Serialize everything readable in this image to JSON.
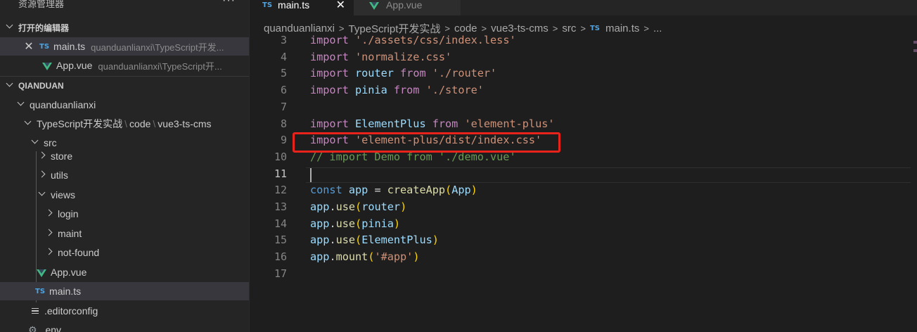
{
  "sidebar": {
    "title": "资源管理器",
    "more": "···",
    "open_editors_label": "打开的编辑器",
    "open_editors": [
      {
        "name": "main.ts",
        "path": "quanduanlianxi\\TypeScript开发...",
        "icon": "ts-icon"
      },
      {
        "name": "App.vue",
        "path": "quanduanlianxi\\TypeScript开...",
        "icon": "vue-icon"
      }
    ],
    "workspace_label": "QIANDUAN",
    "tree": {
      "root": "quanduanlianxi",
      "project_parts": [
        "TypeScript开发实战",
        "code",
        "vue3-ts-cms"
      ],
      "src": "src",
      "store": "store",
      "utils": "utils",
      "views": "views",
      "login": "login",
      "maint": "maint",
      "not_found": "not-found",
      "app_vue": "App.vue",
      "main_ts": "main.ts",
      "editorconfig": ".editorconfig",
      "env": ".env"
    }
  },
  "tabs": [
    {
      "label": "main.ts",
      "icon_text": "TS",
      "close": "✕"
    },
    {
      "label": "App.vue"
    }
  ],
  "breadcrumb": [
    "quanduanlianxi",
    "TypeScript开发实战",
    "code",
    "vue3-ts-cms",
    "src",
    "main.ts",
    "..."
  ],
  "ts_icon_text": "TS",
  "editor": {
    "lines": [
      {
        "n": "3",
        "t": [
          [
            "k",
            "import "
          ],
          [
            "s",
            "'./assets/css/index.less'"
          ]
        ]
      },
      {
        "n": "4",
        "t": [
          [
            "k",
            "import "
          ],
          [
            "s",
            "'normalize.css'"
          ]
        ]
      },
      {
        "n": "5",
        "t": [
          [
            "k",
            "import "
          ],
          [
            "v",
            "router"
          ],
          [
            "k",
            " from "
          ],
          [
            "s",
            "'./router'"
          ]
        ]
      },
      {
        "n": "6",
        "t": [
          [
            "k",
            "import "
          ],
          [
            "v",
            "pinia"
          ],
          [
            "k",
            " from "
          ],
          [
            "s",
            "'./store'"
          ]
        ]
      },
      {
        "n": "7",
        "t": []
      },
      {
        "n": "8",
        "t": [
          [
            "k",
            "import "
          ],
          [
            "v",
            "ElementPlus"
          ],
          [
            "k",
            " from "
          ],
          [
            "s",
            "'element-plus'"
          ]
        ]
      },
      {
        "n": "9",
        "t": [
          [
            "k",
            "import "
          ],
          [
            "s",
            "'element-plus/dist/index.css'"
          ]
        ]
      },
      {
        "n": "10",
        "t": [
          [
            "c",
            "// import Demo from './demo.vue'"
          ]
        ]
      },
      {
        "n": "11",
        "t": []
      },
      {
        "n": "12",
        "t": [
          [
            "b",
            "const "
          ],
          [
            "v",
            "app"
          ],
          [
            "p",
            " = "
          ],
          [
            "f",
            "createApp"
          ],
          [
            "y",
            "("
          ],
          [
            "v",
            "App"
          ],
          [
            "y",
            ")"
          ]
        ]
      },
      {
        "n": "13",
        "t": [
          [
            "v",
            "app"
          ],
          [
            "p",
            "."
          ],
          [
            "f",
            "use"
          ],
          [
            "y",
            "("
          ],
          [
            "v",
            "router"
          ],
          [
            "y",
            ")"
          ]
        ]
      },
      {
        "n": "14",
        "t": [
          [
            "v",
            "app"
          ],
          [
            "p",
            "."
          ],
          [
            "f",
            "use"
          ],
          [
            "y",
            "("
          ],
          [
            "v",
            "pinia"
          ],
          [
            "y",
            ")"
          ]
        ]
      },
      {
        "n": "15",
        "t": [
          [
            "v",
            "app"
          ],
          [
            "p",
            "."
          ],
          [
            "f",
            "use"
          ],
          [
            "y",
            "("
          ],
          [
            "v",
            "ElementPlus"
          ],
          [
            "y",
            ")"
          ]
        ]
      },
      {
        "n": "16",
        "t": [
          [
            "v",
            "app"
          ],
          [
            "p",
            "."
          ],
          [
            "f",
            "mount"
          ],
          [
            "y",
            "("
          ],
          [
            "s",
            "'#app'"
          ],
          [
            "y",
            ")"
          ]
        ]
      },
      {
        "n": "17",
        "t": []
      }
    ],
    "current_line": "11",
    "highlighted_line": "9"
  },
  "colors": {
    "keyword": "#c586c0",
    "string": "#ce9178",
    "variable": "#9cdcfe",
    "comment": "#6a9955",
    "function": "#dcdcaa",
    "highlight_box": "#e8231c"
  }
}
